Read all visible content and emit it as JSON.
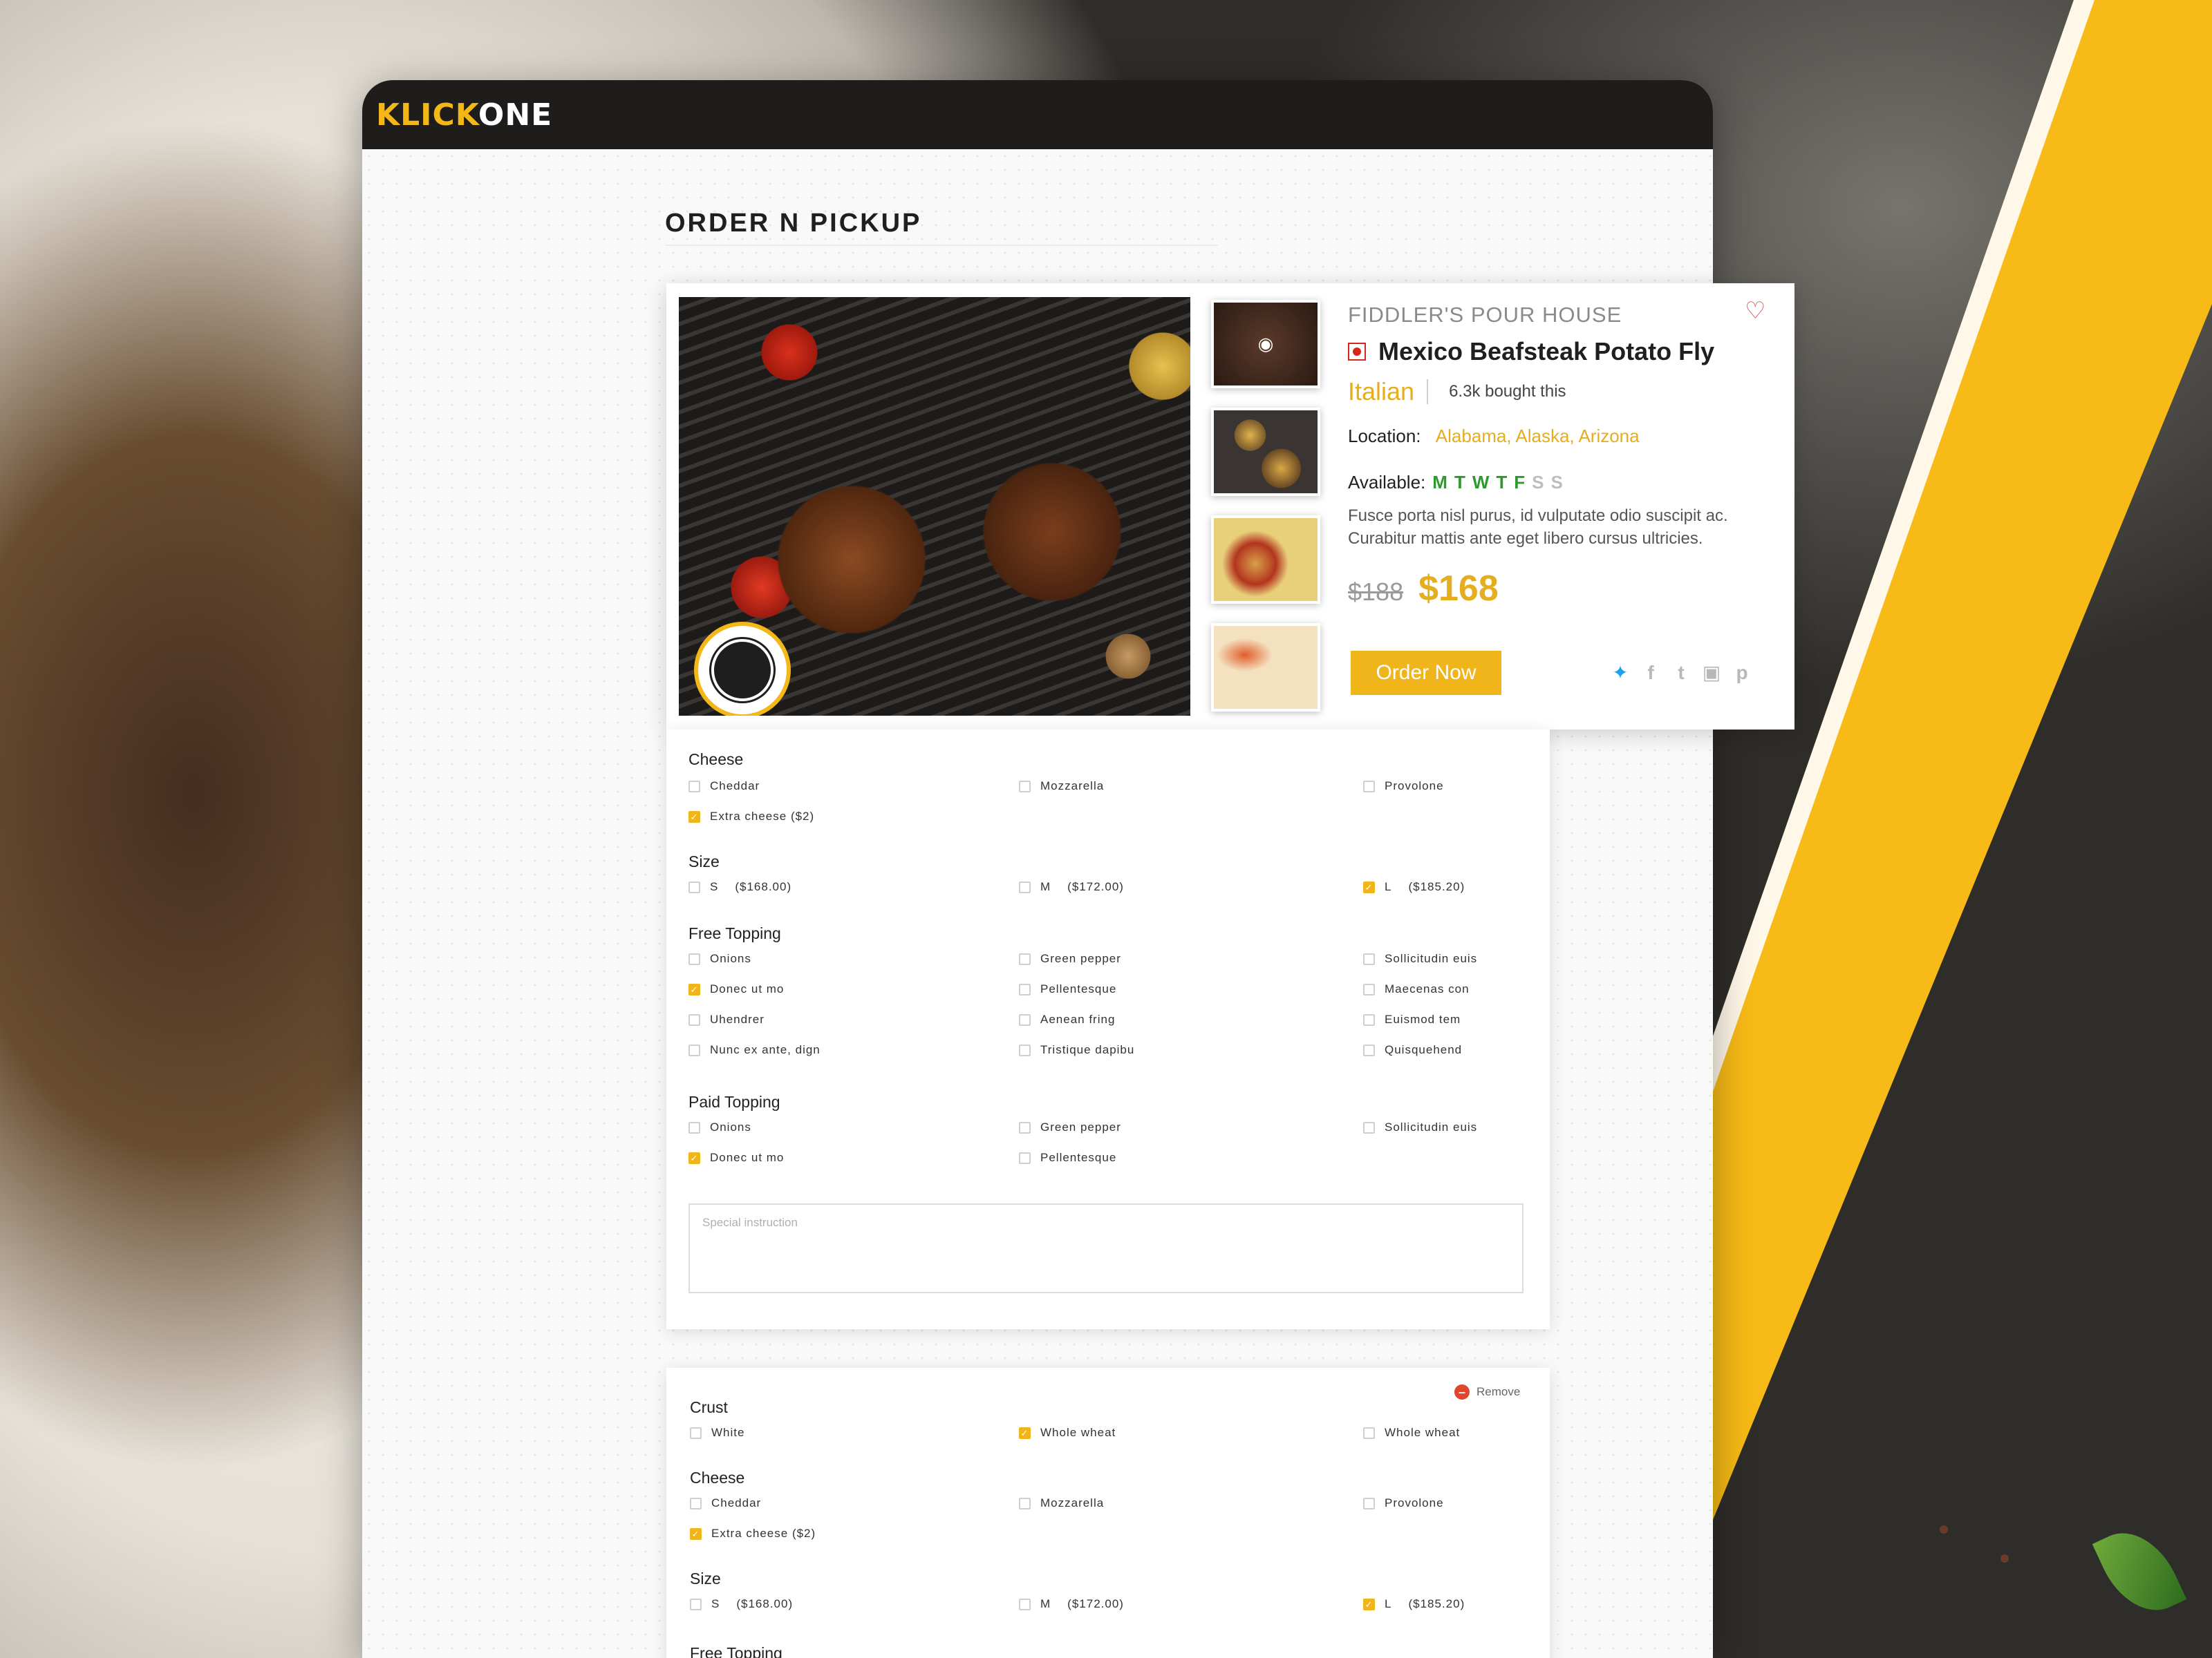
{
  "app": {
    "logo_part1": "KLICK",
    "logo_part2": "ONE",
    "page_title": "ORDER N PICKUP"
  },
  "product": {
    "restaurant": "FIDDLER'S POUR HOUSE",
    "dish_name": "Mexico Beafsteak Potato Fly",
    "cuisine": "Italian",
    "bought": "6.3k bought this",
    "location_label": "Location:",
    "location_value": "Alabama, Alaska, Arizona",
    "available_label": "Available:",
    "days": [
      {
        "letter": "M",
        "available": true
      },
      {
        "letter": "T",
        "available": true
      },
      {
        "letter": "W",
        "available": true
      },
      {
        "letter": "T",
        "available": true
      },
      {
        "letter": "F",
        "available": true
      },
      {
        "letter": "S",
        "available": false
      },
      {
        "letter": "S",
        "available": false
      }
    ],
    "description": "Fusce porta nisl purus, id vulputate odio suscipit ac. Curabitur mattis ante eget libero cursus ultricies.",
    "old_price": "$188",
    "new_price": "$168",
    "order_button": "Order Now",
    "social_icons": [
      "twitter-icon",
      "facebook-icon",
      "tumblr-icon",
      "instagram-icon",
      "pinterest-icon"
    ],
    "accent_color": "#efb51b"
  },
  "panel1": {
    "cheese": {
      "title": "Cheese",
      "options": [
        {
          "label": "Cheddar",
          "checked": false
        },
        {
          "label": "Mozzarella",
          "checked": false
        },
        {
          "label": "Provolone",
          "checked": false
        },
        {
          "label": "Extra cheese ($2)",
          "checked": true
        }
      ]
    },
    "size": {
      "title": "Size",
      "options": [
        {
          "label": "S",
          "price": "($168.00)",
          "checked": false
        },
        {
          "label": "M",
          "price": "($172.00)",
          "checked": false
        },
        {
          "label": "L",
          "price": "($185.20)",
          "checked": true
        }
      ]
    },
    "free_topping": {
      "title": "Free Topping",
      "options": [
        {
          "label": "Onions",
          "checked": false
        },
        {
          "label": "Green pepper",
          "checked": false
        },
        {
          "label": "Sollicitudin euis",
          "checked": false
        },
        {
          "label": "Donec ut mo",
          "checked": true
        },
        {
          "label": "Pellentesque",
          "checked": false
        },
        {
          "label": "Maecenas con",
          "checked": false
        },
        {
          "label": "Uhendrer",
          "checked": false
        },
        {
          "label": "Aenean fring",
          "checked": false
        },
        {
          "label": "Euismod tem",
          "checked": false
        },
        {
          "label": "Nunc ex ante, dign",
          "checked": false
        },
        {
          "label": "Tristique dapibu",
          "checked": false
        },
        {
          "label": "Quisquehend",
          "checked": false
        }
      ]
    },
    "paid_topping": {
      "title": "Paid Topping",
      "options": [
        {
          "label": "Onions",
          "checked": false
        },
        {
          "label": "Green pepper",
          "checked": false
        },
        {
          "label": "Sollicitudin euis",
          "checked": false
        },
        {
          "label": "Donec ut mo",
          "checked": true
        },
        {
          "label": "Pellentesque",
          "checked": false
        }
      ]
    },
    "special_placeholder": "Special instruction"
  },
  "panel2": {
    "remove_label": "Remove",
    "crust": {
      "title": "Crust",
      "options": [
        {
          "label": "White",
          "checked": false
        },
        {
          "label": "Whole wheat",
          "checked": true
        },
        {
          "label": "Whole wheat",
          "checked": false
        }
      ]
    },
    "cheese": {
      "title": "Cheese",
      "options": [
        {
          "label": "Cheddar",
          "checked": false
        },
        {
          "label": "Mozzarella",
          "checked": false
        },
        {
          "label": "Provolone",
          "checked": false
        },
        {
          "label": "Extra cheese ($2)",
          "checked": true
        }
      ]
    },
    "size": {
      "title": "Size",
      "options": [
        {
          "label": "S",
          "price": "($168.00)",
          "checked": false
        },
        {
          "label": "M",
          "price": "($172.00)",
          "checked": false
        },
        {
          "label": "L",
          "price": "($185.20)",
          "checked": true
        }
      ]
    },
    "free_topping": {
      "title": "Free Topping"
    }
  }
}
